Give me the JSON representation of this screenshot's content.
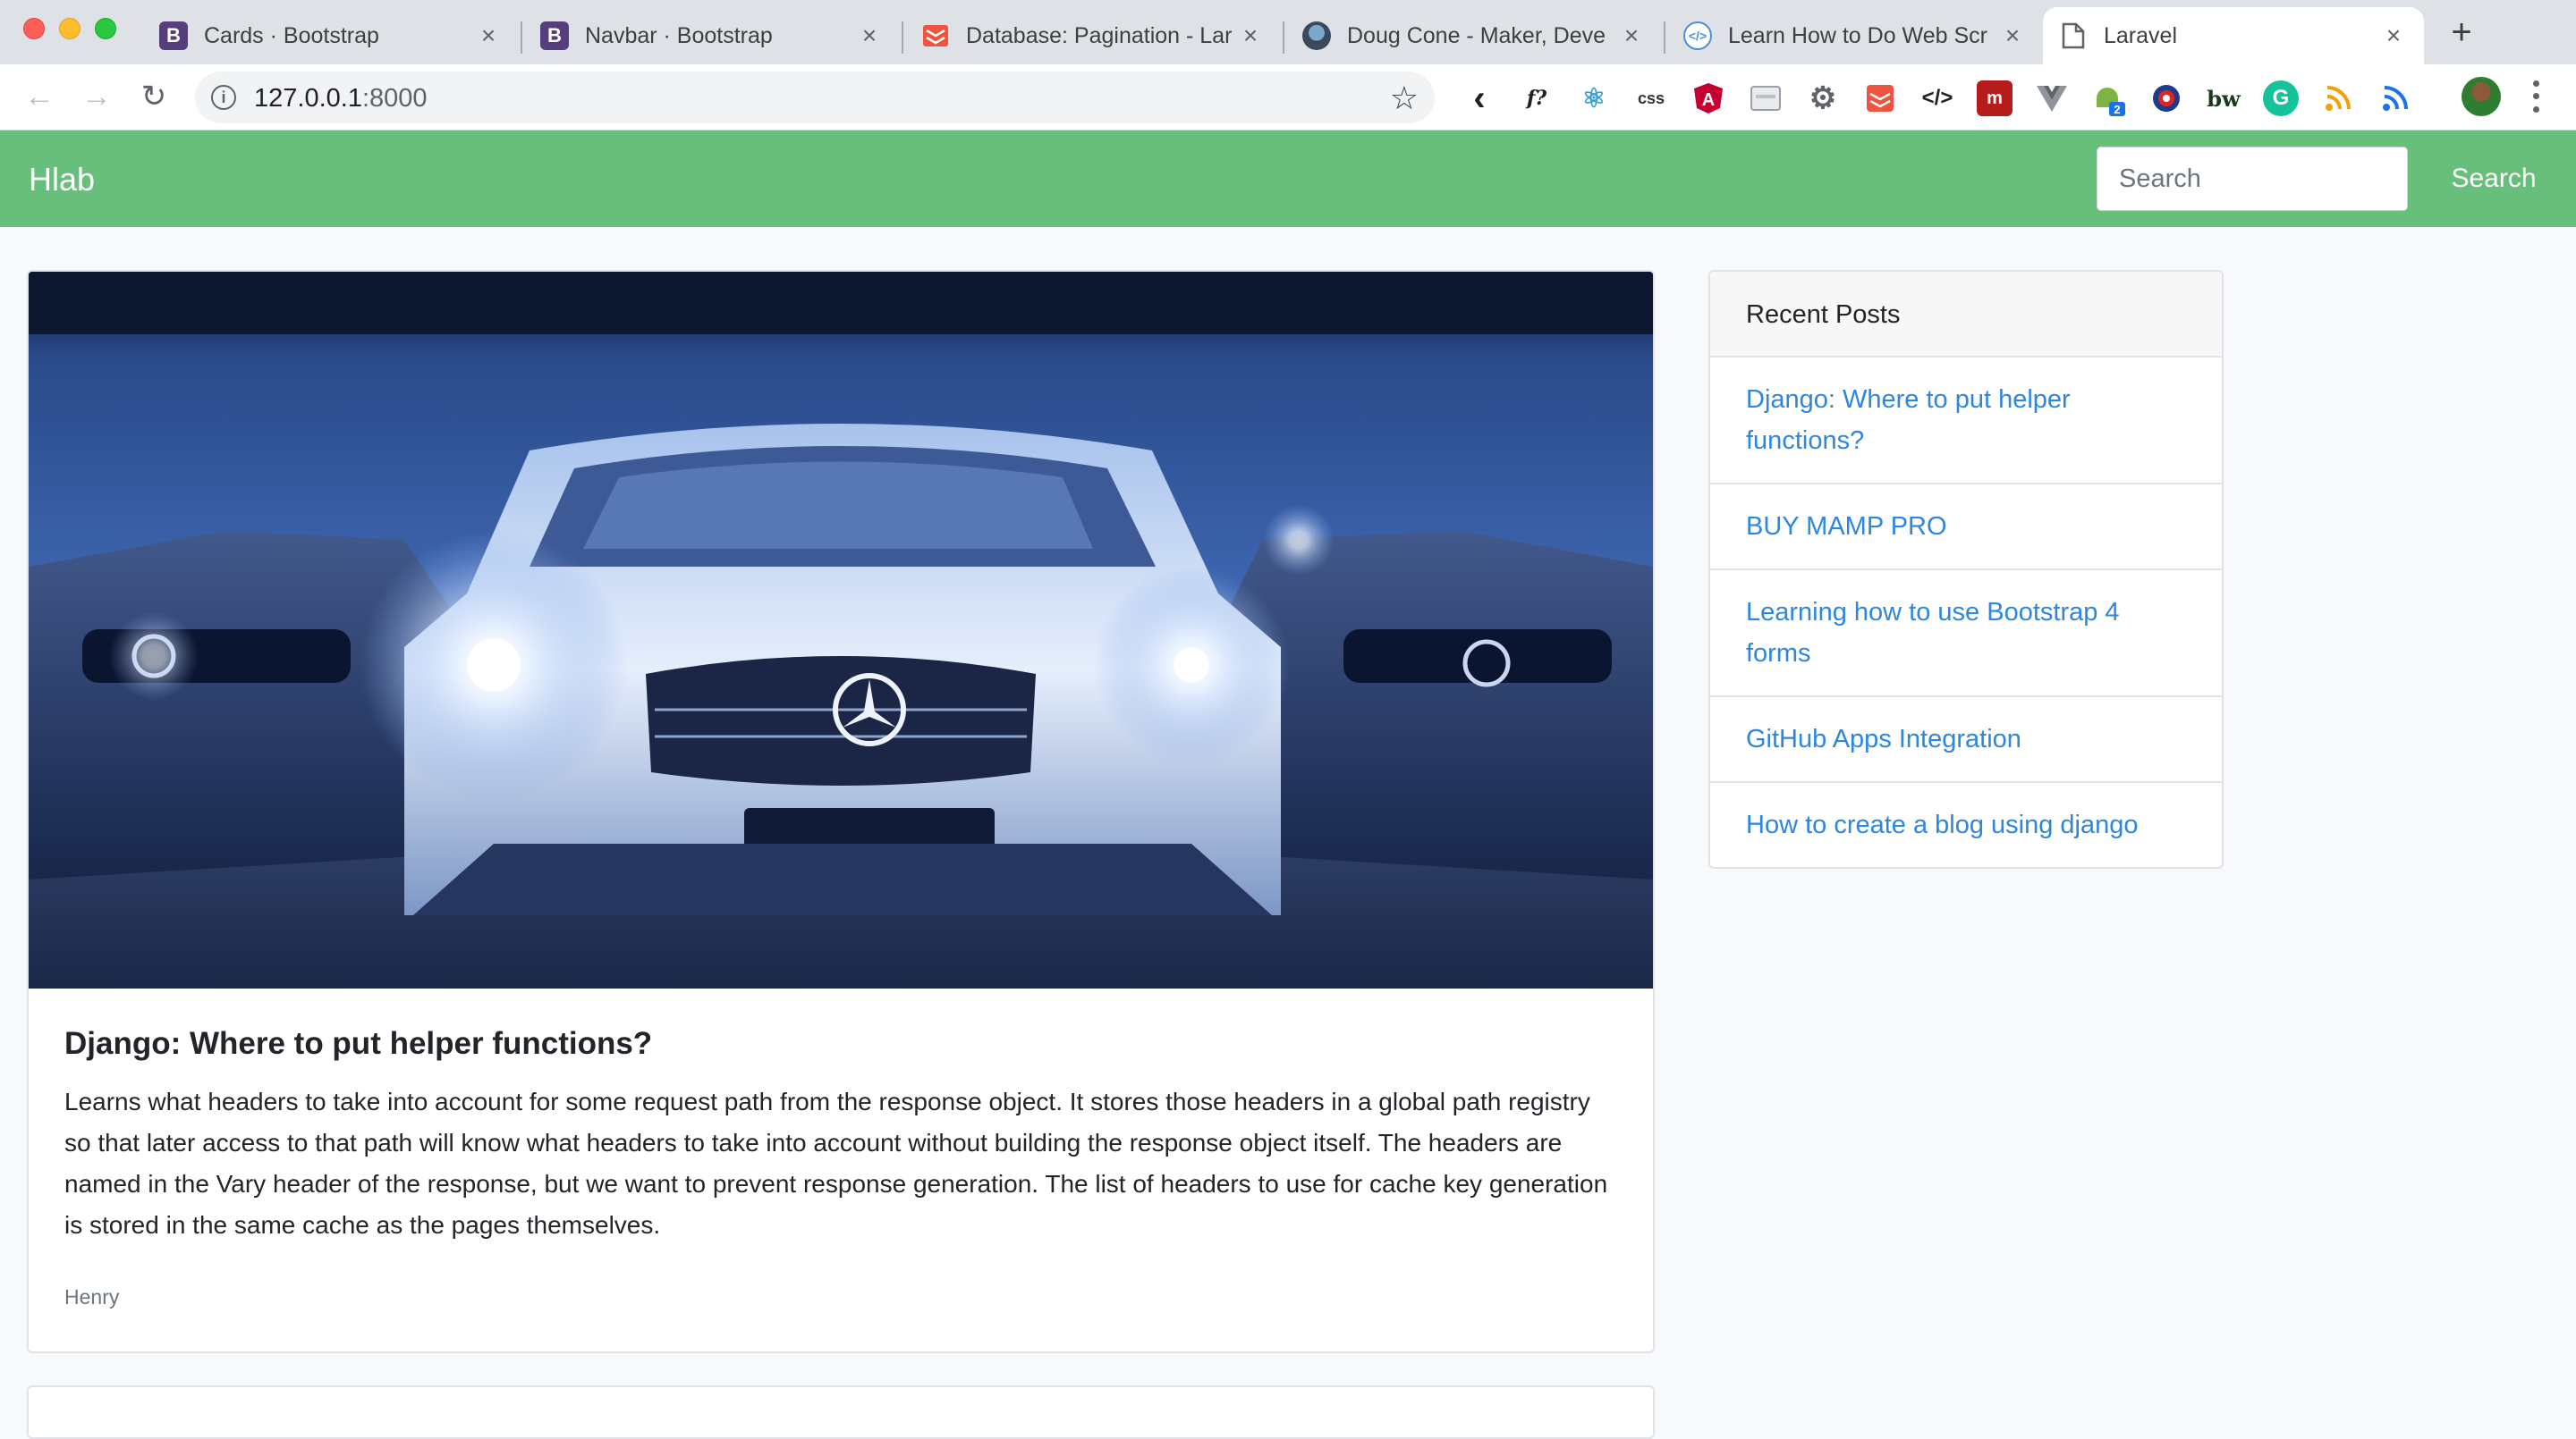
{
  "browser": {
    "tabs": [
      {
        "title": "Cards · Bootstrap",
        "icon": "bootstrap-icon"
      },
      {
        "title": "Navbar · Bootstrap",
        "icon": "bootstrap-icon"
      },
      {
        "title": "Database: Pagination - Lar",
        "icon": "laravel-icon"
      },
      {
        "title": "Doug Cone - Maker, Deve",
        "icon": "avatar-icon"
      },
      {
        "title": "Learn How to Do Web Scr",
        "icon": "web-icon"
      },
      {
        "title": "Laravel",
        "icon": "page-icon"
      }
    ],
    "address": {
      "host": "127.0.0.1",
      "port": ":8000"
    },
    "bootstrap_glyph": "B",
    "extension_labels": {
      "f": "f?",
      "css": "css",
      "bw": "bw",
      "badge": "2"
    }
  },
  "navbar": {
    "brand": "Hlab",
    "search_placeholder": "Search",
    "search_button": "Search",
    "color": "#68bf7b"
  },
  "post": {
    "title": "Django: Where to put helper functions?",
    "body": "Learns what headers to take into account for some request path from the response object. It stores those headers in a global path registry so that later access to that path will know what headers to take into account without building the response object itself. The headers are named in the Vary header of the response, but we want to prevent response generation. The list of headers to use for cache key generation is stored in the same cache as the pages themselves.",
    "author": "Henry"
  },
  "sidebar": {
    "title": "Recent Posts",
    "items": [
      {
        "label": "Django: Where to put helper functions?"
      },
      {
        "label": "BUY MAMP PRO"
      },
      {
        "label": "Learning how to use Bootstrap 4 forms"
      },
      {
        "label": "GitHub Apps Integration"
      },
      {
        "label": "How to create a blog using django"
      }
    ],
    "link_color": "#2e86de"
  }
}
